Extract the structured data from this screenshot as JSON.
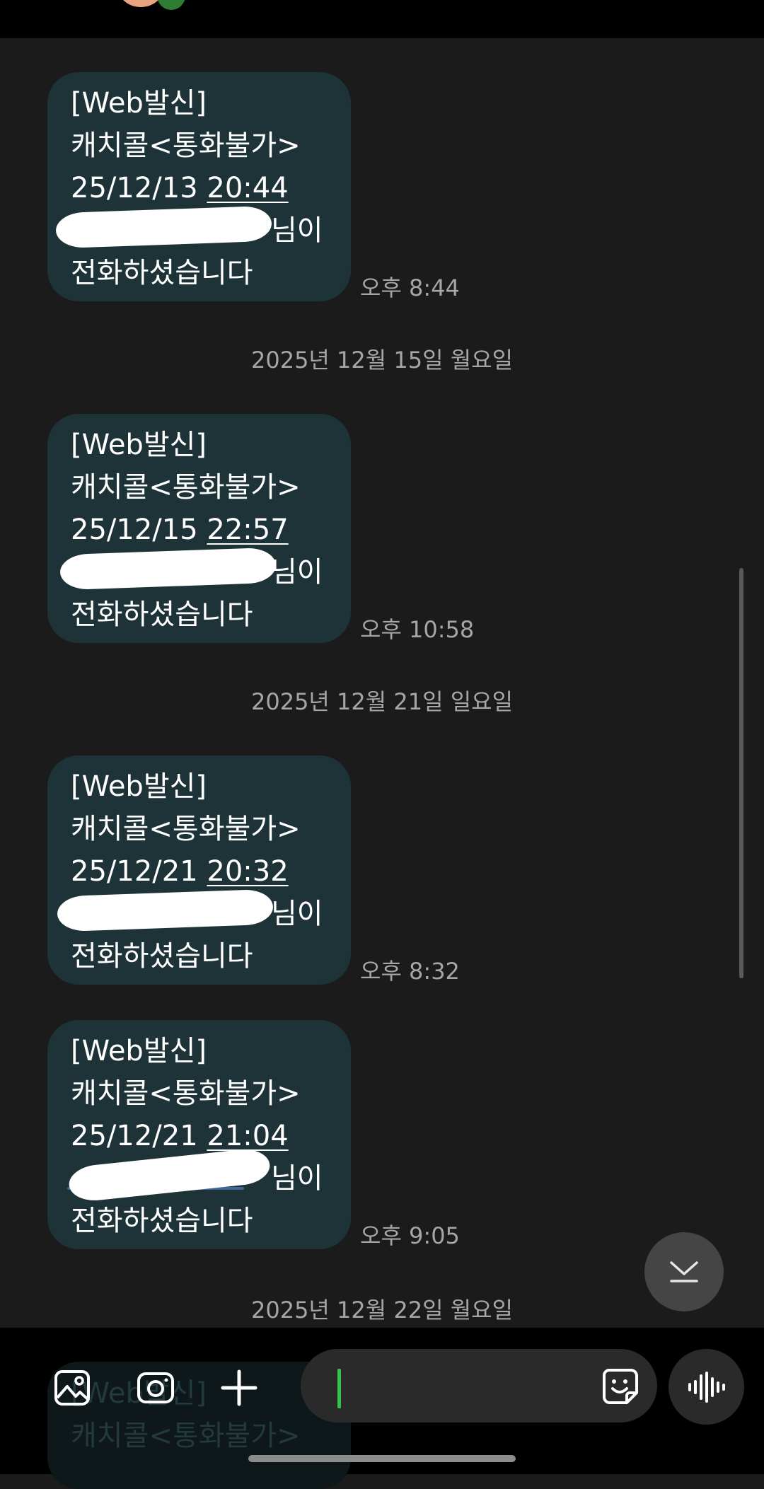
{
  "messages": [
    {
      "l1": "[Web발신]",
      "l2": "캐치콜<통화불가>",
      "date": "25/12/13",
      "time": "20:44",
      "suffix": "님이",
      "l5": "전화하셨습니다",
      "sent": "오후 8:44"
    },
    {
      "l1": "[Web발신]",
      "l2": "캐치콜<통화불가>",
      "date": "25/12/15",
      "time": "22:57",
      "suffix": "님이",
      "l5": "전화하셨습니다",
      "sent": "오후 10:58"
    },
    {
      "l1": "[Web발신]",
      "l2": "캐치콜<통화불가>",
      "date": "25/12/21",
      "time": "20:32",
      "suffix": "님이",
      "l5": "전화하셨습니다",
      "sent": "오후 8:32"
    },
    {
      "l1": "[Web발신]",
      "l2": "캐치콜<통화불가>",
      "date": "25/12/21",
      "time": "21:04",
      "suffix": "님이",
      "l5": "전화하셨습니다",
      "sent": "오후 9:05"
    }
  ],
  "separators": [
    "2025년 12월 15일 월요일",
    "2025년 12월 21일 일요일",
    "2025년 12월 22일 월요일"
  ],
  "ghost": {
    "l1": "[Web발신]",
    "l2": "캐치콜<통화불가>"
  },
  "composer": {
    "placeholder": ""
  },
  "colors": {
    "bubble": "#1e3338",
    "background": "#1b1b1b",
    "cursor": "#36c24a",
    "meta_text": "#a6a6a6"
  },
  "icons": [
    "gallery-icon",
    "camera-icon",
    "plus-icon",
    "sticker-icon",
    "voice-wave-icon",
    "scroll-down-icon"
  ]
}
